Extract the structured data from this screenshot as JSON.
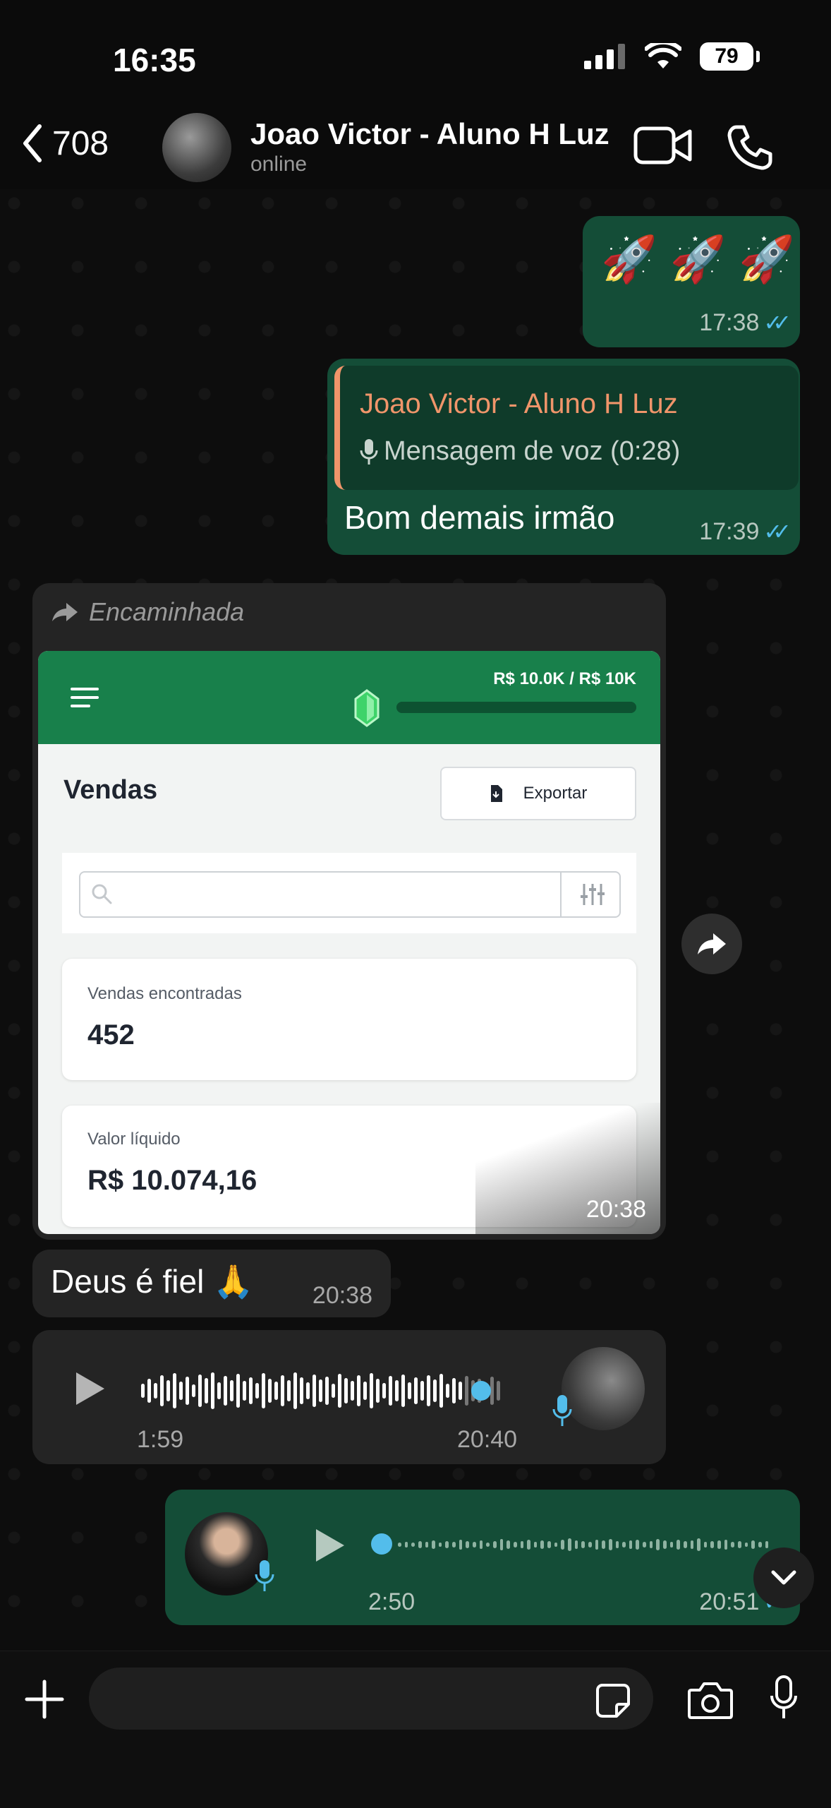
{
  "status": {
    "time": "16:35",
    "battery": "79"
  },
  "header": {
    "back_count": "708",
    "name": "Joao Victor - Aluno H Luz",
    "status": "online"
  },
  "messages": {
    "m1": {
      "emoji": "🚀 🚀 🚀",
      "time": "17:38"
    },
    "m2": {
      "quote_author": "Joao Victor - Aluno H Luz",
      "quote_text": "Mensagem de voz (0:28)",
      "text": "Bom demais irmão",
      "time": "17:39"
    },
    "m3": {
      "forwarded_label": "Encaminhada",
      "time": "20:38",
      "app": {
        "progress_label": "R$ 10.0K / R$ 10K",
        "progress_fraction": 1.0,
        "title": "Vendas",
        "export_label": "Exportar",
        "search_placeholder": "",
        "card1_label": "Vendas encontradas",
        "card1_value": "452",
        "card2_label": "Valor líquido",
        "card2_value": "R$ 10.074,16"
      }
    },
    "m4": {
      "text": "Deus é fiel 🙏",
      "time": "20:38"
    },
    "m5": {
      "duration": "1:59",
      "time": "20:40"
    },
    "m6": {
      "duration": "2:50",
      "time": "20:51"
    }
  },
  "colors": {
    "outgoing_bubble": "#144d37",
    "incoming_bubble": "#242424",
    "accent_blue": "#53bdeb",
    "app_green": "#18804b",
    "quote_orange": "#f0956a"
  },
  "icons": [
    "chevron-left-icon",
    "video-icon",
    "phone-icon",
    "forward-icon",
    "menu-icon",
    "gem-icon",
    "export-icon",
    "search-icon",
    "filter-icon",
    "play-icon",
    "mic-icon",
    "chevron-down-icon",
    "plus-icon",
    "sticker-icon",
    "camera-icon"
  ]
}
